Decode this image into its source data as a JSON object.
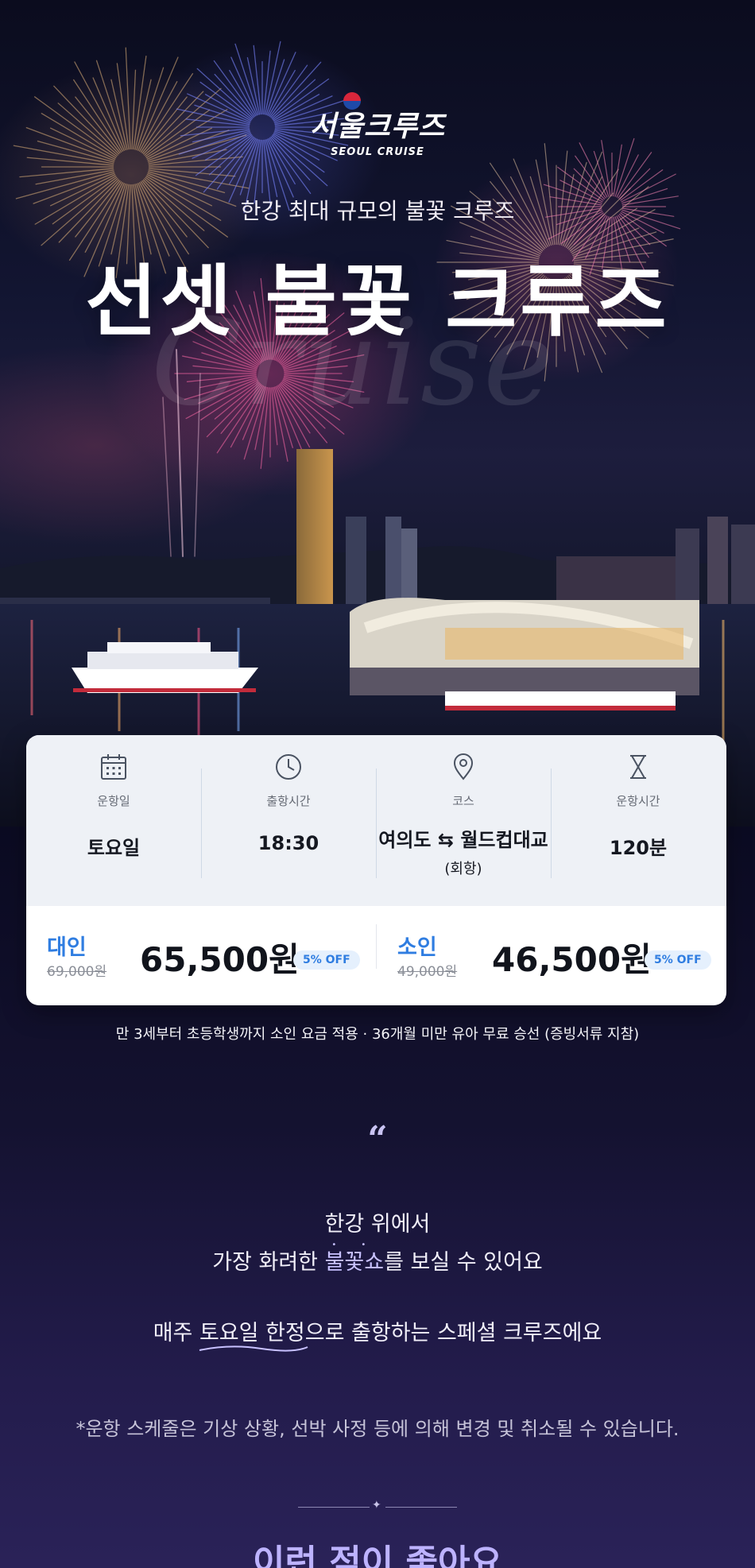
{
  "brand": {
    "name": "서울크루즈",
    "subtitle": "SEOUL CRUISE"
  },
  "hero": {
    "kicker": "한강 최대 규모의 불꽃 크루즈",
    "headline": "선셋 불꽃 크루즈",
    "script_text": "Cruise"
  },
  "info": {
    "columns": [
      {
        "icon": "calendar-icon",
        "label": "운항일",
        "value": "토요일"
      },
      {
        "icon": "clock-icon",
        "label": "출항시간",
        "value": "18:30"
      },
      {
        "icon": "location-pin-icon",
        "label": "코스",
        "value": "여의도 ⇆ 월드컵대교",
        "sub": "(회항)"
      },
      {
        "icon": "hourglass-icon",
        "label": "운항시간",
        "value": "120분"
      }
    ]
  },
  "prices": [
    {
      "who": "대인",
      "original": "69,000원",
      "price": "65,500원",
      "discount": "5% OFF"
    },
    {
      "who": "소인",
      "original": "49,000원",
      "price": "46,500원",
      "discount": "5% OFF"
    }
  ],
  "notice": "만 3세부터 초등학생까지 소인 요금 적용 · 36개월 미만 유아 무료 승선 (증빙서류 지참)",
  "story": {
    "quote_mark": "“",
    "line1": "한강 위에서",
    "line2_pre": "가장 화려한 ",
    "line2_highlight": "불꽃쇼",
    "line2_post": "를 보실 수 있어요",
    "line3_pre": "매주 ",
    "line3_underline": "토요일 한정",
    "line3_post": "으로 출항하는 스페셜 크루즈에요",
    "disclaimer": "*운항 스케줄은 기상 상황, 선박 사정 등에 의해 변경 및 취소될 수 있습니다.",
    "divider_symbol": "✦",
    "section_title": "이런 점이 좋아요"
  },
  "colors": {
    "accent_blue": "#2f7de1",
    "highlight_purple": "#c8c1ff",
    "card_top": "#eef1f6"
  }
}
